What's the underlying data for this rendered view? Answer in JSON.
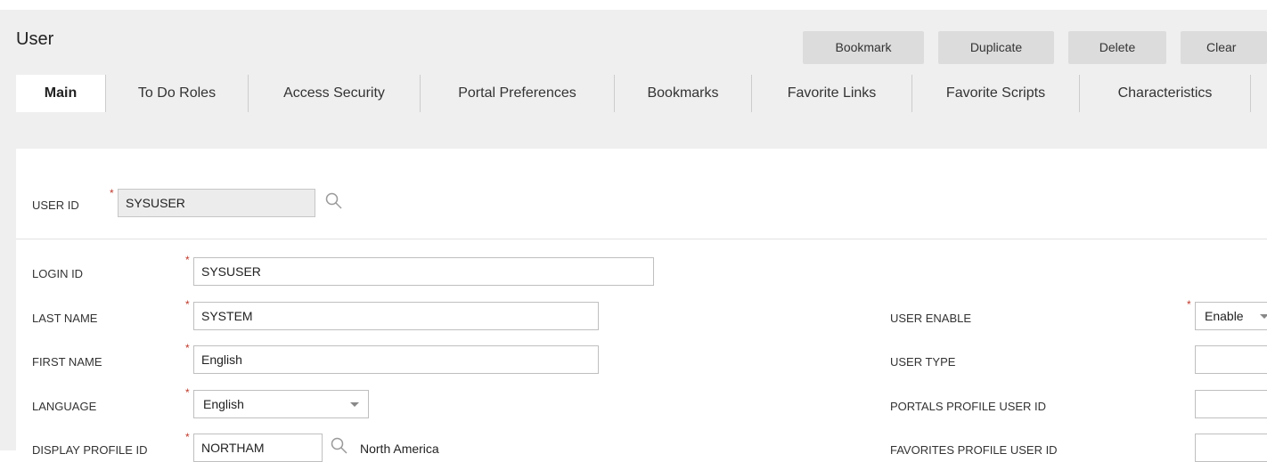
{
  "header": {
    "title": "User",
    "bookmark_label": "Bookmark",
    "duplicate_label": "Duplicate",
    "delete_label": "Delete",
    "clear_label": "Clear"
  },
  "tabs": [
    {
      "label": "Main",
      "active": true
    },
    {
      "label": "To Do Roles"
    },
    {
      "label": "Access Security"
    },
    {
      "label": "Portal Preferences"
    },
    {
      "label": "Bookmarks"
    },
    {
      "label": "Favorite Links"
    },
    {
      "label": "Favorite Scripts"
    },
    {
      "label": "Characteristics"
    }
  ],
  "form": {
    "user_id": {
      "label": "USER ID",
      "value": "SYSUSER"
    },
    "login_id": {
      "label": "LOGIN ID",
      "value": "SYSUSER"
    },
    "last_name": {
      "label": "LAST NAME",
      "value": "SYSTEM"
    },
    "first_name": {
      "label": "FIRST NAME",
      "value": "English"
    },
    "language": {
      "label": "LANGUAGE",
      "value": "English"
    },
    "display_profile_id": {
      "label": "DISPLAY PROFILE ID",
      "value": "NORTHAM",
      "description": "North America"
    },
    "user_enable": {
      "label": "USER ENABLE",
      "value": "Enable"
    },
    "user_type": {
      "label": "USER TYPE",
      "value": ""
    },
    "portals_profile_user_id": {
      "label": "PORTALS PROFILE USER ID",
      "value": ""
    },
    "favorites_profile_user_id": {
      "label": "FAVORITES PROFILE USER ID",
      "value": ""
    }
  },
  "required_marker": "*",
  "colors": {
    "required": "#c0392b",
    "toolbar_button": "#dcdcdc",
    "background": "#efefef"
  }
}
